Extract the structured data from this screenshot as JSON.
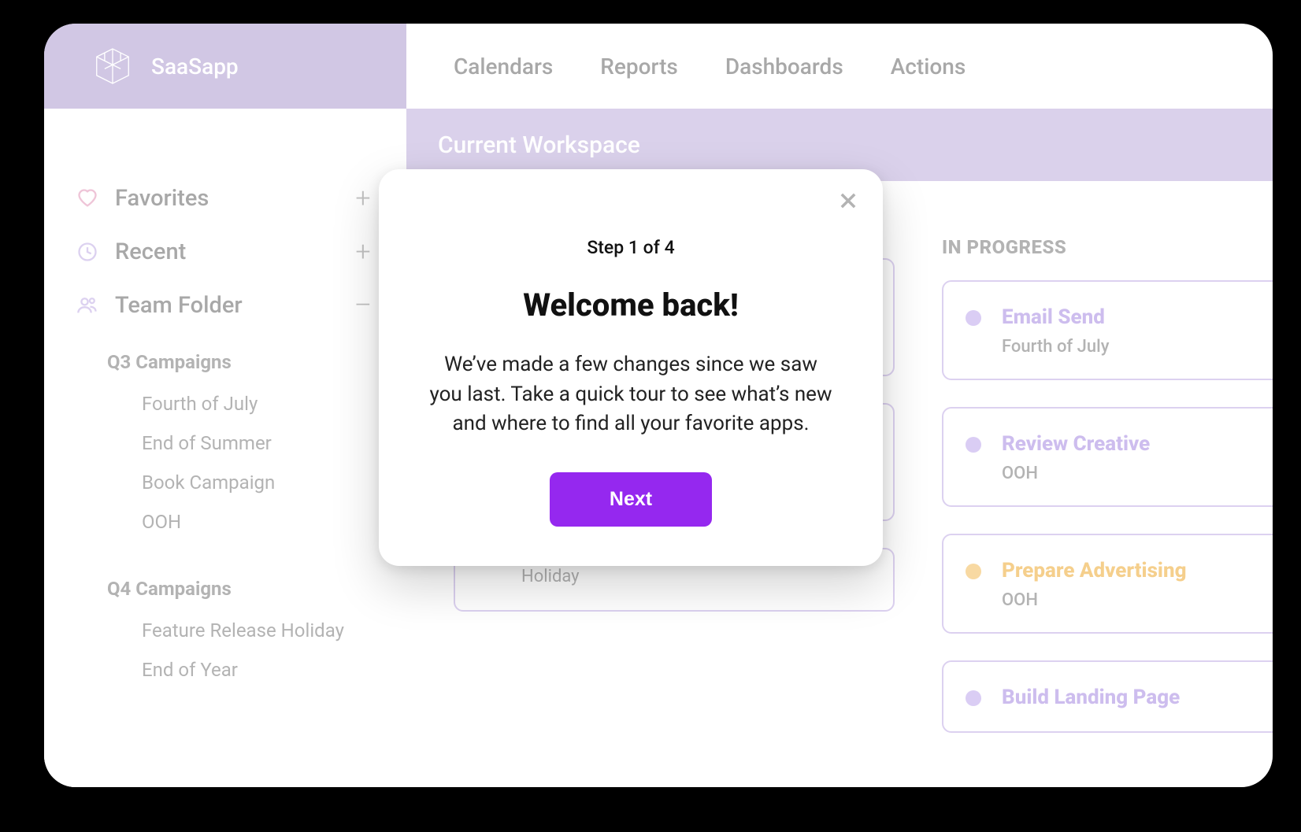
{
  "brand": {
    "name": "SaaSapp"
  },
  "topnav": {
    "items": [
      {
        "label": "Calendars"
      },
      {
        "label": "Reports"
      },
      {
        "label": "Dashboards"
      },
      {
        "label": "Actions"
      }
    ]
  },
  "workspace": {
    "title": "Current Workspace"
  },
  "sidebar": {
    "favorites": {
      "label": "Favorites",
      "action": "+"
    },
    "recent": {
      "label": "Recent",
      "action": "+"
    },
    "team": {
      "label": "Team Folder",
      "action": "–"
    },
    "groups": [
      {
        "title": "Q3 Campaigns",
        "items": [
          {
            "label": "Fourth of July"
          },
          {
            "label": "End of Summer"
          },
          {
            "label": "Book Campaign"
          },
          {
            "label": "OOH"
          }
        ]
      },
      {
        "title": "Q4 Campaigns",
        "items": [
          {
            "label": "Feature Release Holiday"
          },
          {
            "label": "End of Year"
          }
        ]
      }
    ]
  },
  "board": {
    "columns": [
      {
        "title": "",
        "cards": [
          {
            "title": "",
            "sub": "",
            "color": "purple"
          },
          {
            "title": "",
            "sub": "",
            "color": "purple"
          },
          {
            "title": "",
            "sub": "Holiday",
            "color": "purple"
          }
        ]
      },
      {
        "title": "IN PROGRESS",
        "cards": [
          {
            "title": "Email Send",
            "sub": "Fourth of July",
            "color": "purple"
          },
          {
            "title": "Review Creative",
            "sub": "OOH",
            "color": "purple"
          },
          {
            "title": "Prepare Advertising",
            "sub": "OOH",
            "color": "orange"
          },
          {
            "title": "Build Landing Page",
            "sub": "",
            "color": "purple"
          }
        ]
      }
    ]
  },
  "modal": {
    "step": "Step 1 of 4",
    "title": "Welcome back!",
    "body": "We’ve made a few changes since we saw you last. Take a quick tour to see what’s new and where to find all your favorite apps.",
    "next": "Next"
  }
}
